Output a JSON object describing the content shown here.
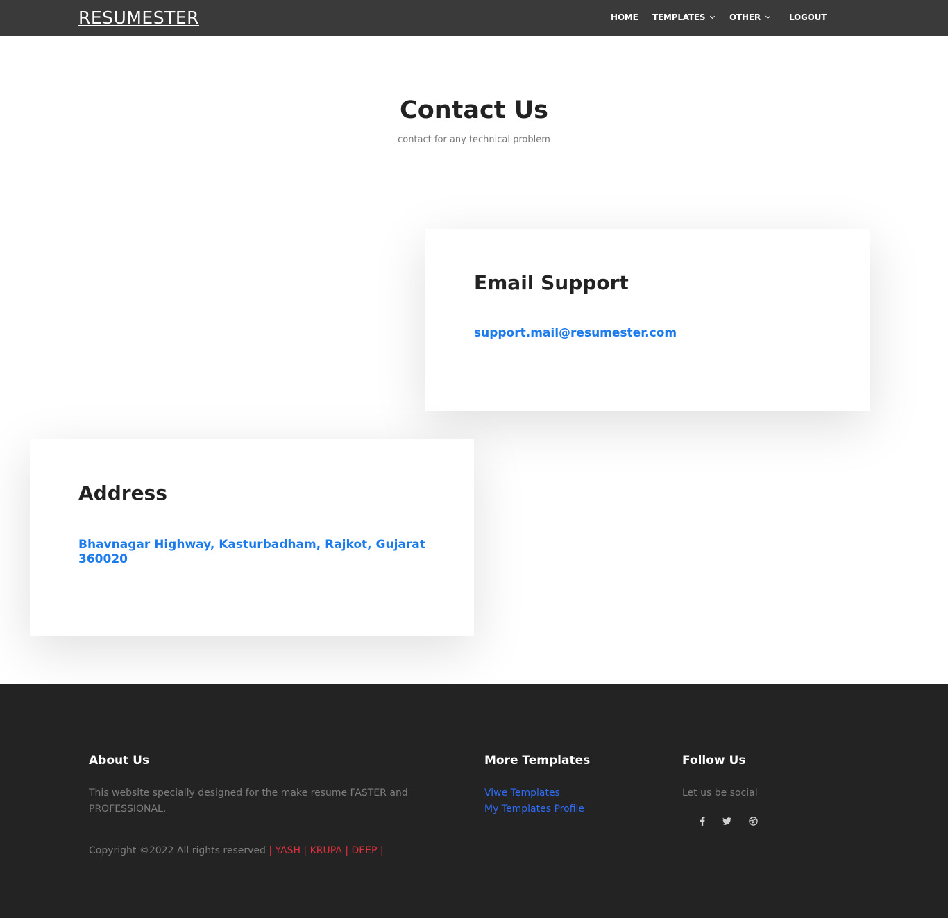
{
  "navbar": {
    "brand": "RESUMESTER",
    "items": [
      {
        "label": "HOME"
      },
      {
        "label": "TEMPLATES"
      },
      {
        "label": "OTHER"
      },
      {
        "label": "LOGOUT"
      }
    ]
  },
  "hero": {
    "title": "Contact Us",
    "subtitle": "contact for any technical problem"
  },
  "cards": {
    "email": {
      "title": "Email Support",
      "value": "support.mail@resumester.com"
    },
    "address": {
      "title": "Address",
      "value": "Bhavnagar Highway, Kasturbadham, Rajkot, Gujarat 360020"
    }
  },
  "footer": {
    "about": {
      "title": "About Us",
      "text": "This website specially designed for the make resume FASTER and PROFESSIONAL."
    },
    "templates": {
      "title": "More Templates",
      "links": [
        "Viwe Templates",
        "My Templates Profile"
      ]
    },
    "follow": {
      "title": "Follow Us",
      "text": "Let us be social",
      "icons": [
        "facebook-icon",
        "twitter-icon",
        "dribbble-icon"
      ]
    },
    "copyright": {
      "prefix": "Copyright ©2022 All rights reserved",
      "authors": "| YASH | KRUPA | DEEP |"
    }
  },
  "colors": {
    "navbar_bg": "#3a3a3a",
    "footer_bg": "#232323",
    "link_blue": "#1b7bec",
    "footer_link": "#2f6cf6",
    "author_red": "#e0313f"
  }
}
